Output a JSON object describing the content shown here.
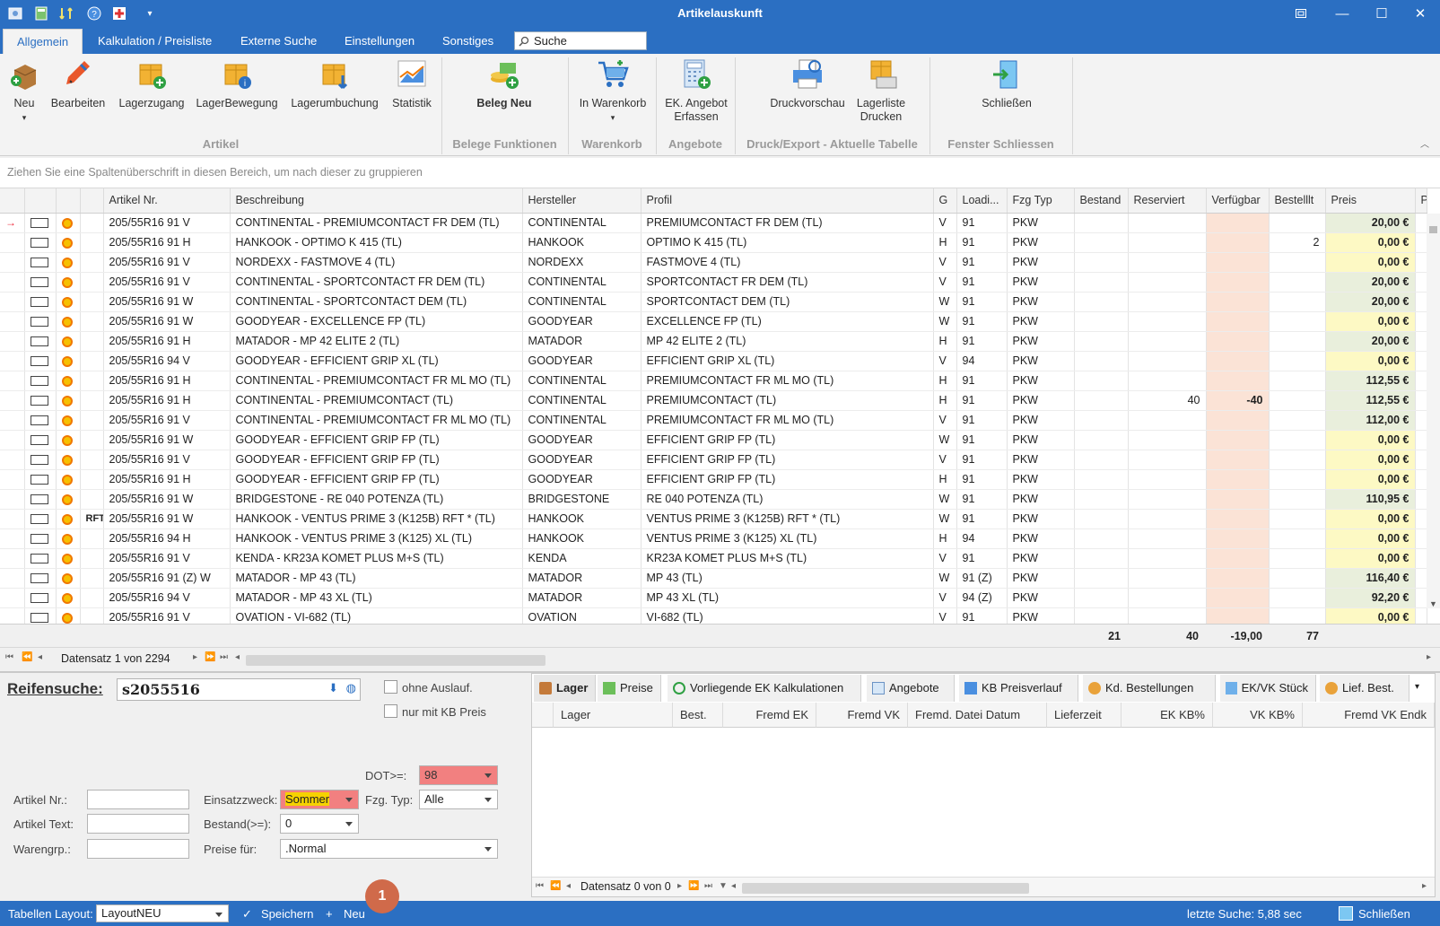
{
  "window": {
    "title": "Artikelauskunft"
  },
  "tabs": [
    "Allgemein",
    "Kalkulation / Preisliste",
    "Externe Suche",
    "Einstellungen",
    "Sonstiges"
  ],
  "search": {
    "placeholder": "Suche"
  },
  "ribbon": {
    "buttons": [
      "Neu",
      "Bearbeiten",
      "Lagerzugang",
      "LagerBewegung",
      "Lagerumbuchung",
      "Statistik",
      "Beleg Neu",
      "In Warenkorb",
      "EK. Angebot Erfassen",
      "Druckvorschau",
      "Lagerliste Drucken",
      "Schließen"
    ],
    "groups": [
      "Artikel",
      "Belege Funktionen",
      "Warenkorb",
      "Angebote",
      "Druck/Export - Aktuelle Tabelle",
      "Fenster Schliessen"
    ]
  },
  "grid": {
    "group_hint": "Ziehen Sie eine Spaltenüberschrift in diesen Bereich, um nach dieser zu gruppieren",
    "columns": [
      "Artikel Nr.",
      "Beschreibung",
      "Hersteller",
      "Profil",
      "G",
      "Loadi...",
      "Fzg Typ",
      "Bestand",
      "Reserviert",
      "Verfügbar",
      "Bestelllt",
      "Preis",
      "P"
    ],
    "rows": [
      {
        "flag": "",
        "art": "205/55R16 91 V",
        "desc": "CONTINENTAL - PREMIUMCONTACT FR DEM (TL)",
        "hst": "CONTINENTAL",
        "prof": "PREMIUMCONTACT FR DEM (TL)",
        "g": "V",
        "li": "91",
        "fzg": "PKW",
        "bst": "",
        "res": "",
        "verf": "",
        "bestellt": "",
        "preis": "20,00 €",
        "pc": "green"
      },
      {
        "flag": "",
        "art": "205/55R16 91 H",
        "desc": "HANKOOK - OPTIMO K 415 (TL)",
        "hst": "HANKOOK",
        "prof": "OPTIMO K 415 (TL)",
        "g": "H",
        "li": "91",
        "fzg": "PKW",
        "bst": "",
        "res": "",
        "verf": "",
        "bestellt": "2",
        "preis": "0,00 €",
        "pc": "yellow"
      },
      {
        "flag": "",
        "art": "205/55R16 91 V",
        "desc": "NORDEXX - FASTMOVE 4 (TL)",
        "hst": "NORDEXX",
        "prof": "FASTMOVE 4 (TL)",
        "g": "V",
        "li": "91",
        "fzg": "PKW",
        "bst": "",
        "res": "",
        "verf": "",
        "bestellt": "",
        "preis": "0,00 €",
        "pc": "yellow"
      },
      {
        "flag": "",
        "art": "205/55R16 91 V",
        "desc": "CONTINENTAL - SPORTCONTACT FR DEM (TL)",
        "hst": "CONTINENTAL",
        "prof": "SPORTCONTACT FR DEM (TL)",
        "g": "V",
        "li": "91",
        "fzg": "PKW",
        "bst": "",
        "res": "",
        "verf": "",
        "bestellt": "",
        "preis": "20,00 €",
        "pc": "green"
      },
      {
        "flag": "",
        "art": "205/55R16 91 W",
        "desc": "CONTINENTAL - SPORTCONTACT DEM (TL)",
        "hst": "CONTINENTAL",
        "prof": "SPORTCONTACT DEM (TL)",
        "g": "W",
        "li": "91",
        "fzg": "PKW",
        "bst": "",
        "res": "",
        "verf": "",
        "bestellt": "",
        "preis": "20,00 €",
        "pc": "green"
      },
      {
        "flag": "",
        "art": "205/55R16 91 W",
        "desc": "GOODYEAR - EXCELLENCE FP (TL)",
        "hst": "GOODYEAR",
        "prof": "EXCELLENCE FP (TL)",
        "g": "W",
        "li": "91",
        "fzg": "PKW",
        "bst": "",
        "res": "",
        "verf": "",
        "bestellt": "",
        "preis": "0,00 €",
        "pc": "yellow"
      },
      {
        "flag": "",
        "art": "205/55R16 91 H",
        "desc": "MATADOR - MP 42 ELITE 2 (TL)",
        "hst": "MATADOR",
        "prof": "MP 42 ELITE 2 (TL)",
        "g": "H",
        "li": "91",
        "fzg": "PKW",
        "bst": "",
        "res": "",
        "verf": "",
        "bestellt": "",
        "preis": "20,00 €",
        "pc": "green"
      },
      {
        "flag": "",
        "art": "205/55R16 94 V",
        "desc": "GOODYEAR - EFFICIENT GRIP XL (TL)",
        "hst": "GOODYEAR",
        "prof": "EFFICIENT GRIP XL (TL)",
        "g": "V",
        "li": "94",
        "fzg": "PKW",
        "bst": "",
        "res": "",
        "verf": "",
        "bestellt": "",
        "preis": "0,00 €",
        "pc": "yellow"
      },
      {
        "flag": "",
        "art": "205/55R16 91 H",
        "desc": "CONTINENTAL - PREMIUMCONTACT FR ML MO (TL)",
        "hst": "CONTINENTAL",
        "prof": "PREMIUMCONTACT FR ML MO (TL)",
        "g": "H",
        "li": "91",
        "fzg": "PKW",
        "bst": "",
        "res": "",
        "verf": "",
        "bestellt": "",
        "preis": "112,55 €",
        "pc": "green"
      },
      {
        "flag": "",
        "art": "205/55R16 91 H",
        "desc": "CONTINENTAL - PREMIUMCONTACT (TL)",
        "hst": "CONTINENTAL",
        "prof": "PREMIUMCONTACT (TL)",
        "g": "H",
        "li": "91",
        "fzg": "PKW",
        "bst": "",
        "res": "40",
        "verf": "-40",
        "bestellt": "",
        "preis": "112,55 €",
        "pc": "green"
      },
      {
        "flag": "",
        "art": "205/55R16 91 V",
        "desc": "CONTINENTAL - PREMIUMCONTACT FR ML MO (TL)",
        "hst": "CONTINENTAL",
        "prof": "PREMIUMCONTACT FR ML MO (TL)",
        "g": "V",
        "li": "91",
        "fzg": "PKW",
        "bst": "",
        "res": "",
        "verf": "",
        "bestellt": "",
        "preis": "112,00 €",
        "pc": "green"
      },
      {
        "flag": "",
        "art": "205/55R16 91 W",
        "desc": "GOODYEAR - EFFICIENT GRIP FP (TL)",
        "hst": "GOODYEAR",
        "prof": "EFFICIENT GRIP FP (TL)",
        "g": "W",
        "li": "91",
        "fzg": "PKW",
        "bst": "",
        "res": "",
        "verf": "",
        "bestellt": "",
        "preis": "0,00 €",
        "pc": "yellow"
      },
      {
        "flag": "",
        "art": "205/55R16 91 V",
        "desc": "GOODYEAR - EFFICIENT GRIP FP (TL)",
        "hst": "GOODYEAR",
        "prof": "EFFICIENT GRIP FP (TL)",
        "g": "V",
        "li": "91",
        "fzg": "PKW",
        "bst": "",
        "res": "",
        "verf": "",
        "bestellt": "",
        "preis": "0,00 €",
        "pc": "yellow"
      },
      {
        "flag": "",
        "art": "205/55R16 91 H",
        "desc": "GOODYEAR - EFFICIENT GRIP FP (TL)",
        "hst": "GOODYEAR",
        "prof": "EFFICIENT GRIP FP (TL)",
        "g": "H",
        "li": "91",
        "fzg": "PKW",
        "bst": "",
        "res": "",
        "verf": "",
        "bestellt": "",
        "preis": "0,00 €",
        "pc": "yellow"
      },
      {
        "flag": "",
        "art": "205/55R16 91 W",
        "desc": "BRIDGESTONE - RE 040 POTENZA (TL)",
        "hst": "BRIDGESTONE",
        "prof": "RE 040 POTENZA (TL)",
        "g": "W",
        "li": "91",
        "fzg": "PKW",
        "bst": "",
        "res": "",
        "verf": "",
        "bestellt": "",
        "preis": "110,95 €",
        "pc": "green"
      },
      {
        "flag": "RFT",
        "art": "205/55R16 91 W",
        "desc": "HANKOOK - VENTUS PRIME 3 (K125B) RFT * (TL)",
        "hst": "HANKOOK",
        "prof": "VENTUS PRIME 3 (K125B) RFT * (TL)",
        "g": "W",
        "li": "91",
        "fzg": "PKW",
        "bst": "",
        "res": "",
        "verf": "",
        "bestellt": "",
        "preis": "0,00 €",
        "pc": "yellow"
      },
      {
        "flag": "",
        "art": "205/55R16 94 H",
        "desc": "HANKOOK - VENTUS PRIME 3 (K125) XL (TL)",
        "hst": "HANKOOK",
        "prof": "VENTUS PRIME 3 (K125) XL (TL)",
        "g": "H",
        "li": "94",
        "fzg": "PKW",
        "bst": "",
        "res": "",
        "verf": "",
        "bestellt": "",
        "preis": "0,00 €",
        "pc": "yellow"
      },
      {
        "flag": "",
        "art": "205/55R16 91 V",
        "desc": "KENDA - KR23A KOMET PLUS M+S (TL)",
        "hst": "KENDA",
        "prof": "KR23A KOMET PLUS M+S (TL)",
        "g": "V",
        "li": "91",
        "fzg": "PKW",
        "bst": "",
        "res": "",
        "verf": "",
        "bestellt": "",
        "preis": "0,00 €",
        "pc": "yellow"
      },
      {
        "flag": "",
        "art": "205/55R16 91 (Z) W",
        "desc": "MATADOR - MP 43 (TL)",
        "hst": "MATADOR",
        "prof": "MP 43 (TL)",
        "g": "W",
        "li": "91 (Z)",
        "fzg": "PKW",
        "bst": "",
        "res": "",
        "verf": "",
        "bestellt": "",
        "preis": "116,40 €",
        "pc": "green"
      },
      {
        "flag": "",
        "art": "205/55R16 94 V",
        "desc": "MATADOR - MP 43 XL (TL)",
        "hst": "MATADOR",
        "prof": "MP 43 XL (TL)",
        "g": "V",
        "li": "94 (Z)",
        "fzg": "PKW",
        "bst": "",
        "res": "",
        "verf": "",
        "bestellt": "",
        "preis": "92,20 €",
        "pc": "green"
      },
      {
        "flag": "",
        "art": "205/55R16 91 V",
        "desc": "OVATION - VI-682 (TL)",
        "hst": "OVATION",
        "prof": "VI-682 (TL)",
        "g": "V",
        "li": "91",
        "fzg": "PKW",
        "bst": "",
        "res": "",
        "verf": "",
        "bestellt": "",
        "preis": "0,00 €",
        "pc": "yellow"
      }
    ],
    "totals": {
      "bestand": "21",
      "reserviert": "40",
      "verfuegbar": "-19,00",
      "bestellt": "77"
    },
    "nav_text": "Datensatz 1 von 2294"
  },
  "filters": {
    "reifensuche_label": "Reifensuche:",
    "reifensuche_value": "s2055516",
    "ohne_auslauf": "ohne Auslauf.",
    "nur_kb_preis": "nur mit KB Preis",
    "dot_label": "DOT>=:",
    "dot_value": "98",
    "artikel_nr_label": "Artikel Nr.:",
    "artikel_text_label": "Artikel Text:",
    "warengrp_label": "Warengrp.:",
    "einsatzzweck_label": "Einsatzzweck:",
    "einsatzzweck_value": "Sommer",
    "fzg_typ_label": "Fzg. Typ:",
    "fzg_typ_value": "Alle",
    "bestand_label": "Bestand(>=):",
    "bestand_value": "0",
    "preise_label": "Preise für:",
    "preise_value": ".Normal"
  },
  "detail": {
    "tabs": [
      "Lager",
      "Preise",
      "Vorliegende EK Kalkulationen",
      "Angebote",
      "KB Preisverlauf",
      "Kd. Bestellungen",
      "EK/VK Stück",
      "Lief. Best."
    ],
    "columns": [
      "Lager",
      "Best.",
      "Fremd EK",
      "Fremd VK",
      "Fremd. Datei Datum",
      "Lieferzeit",
      "EK KB%",
      "VK KB%",
      "Fremd VK Endk"
    ],
    "nav_text": "Datensatz 0 von 0"
  },
  "statusbar": {
    "layout_label": "Tabellen Layout:",
    "layout_value": "LayoutNEU",
    "save": "Speichern",
    "new": "Neu",
    "last_search": "letzte Suche: 5,88 sec",
    "close": "Schließen",
    "badge": "1"
  },
  "colors": {
    "accent": "#2b6fc2",
    "price_yellow": "#fdf9c4",
    "price_green": "#e9efdc",
    "verfuegbar": "#fbe3d6",
    "dot_field": "#f28080"
  }
}
